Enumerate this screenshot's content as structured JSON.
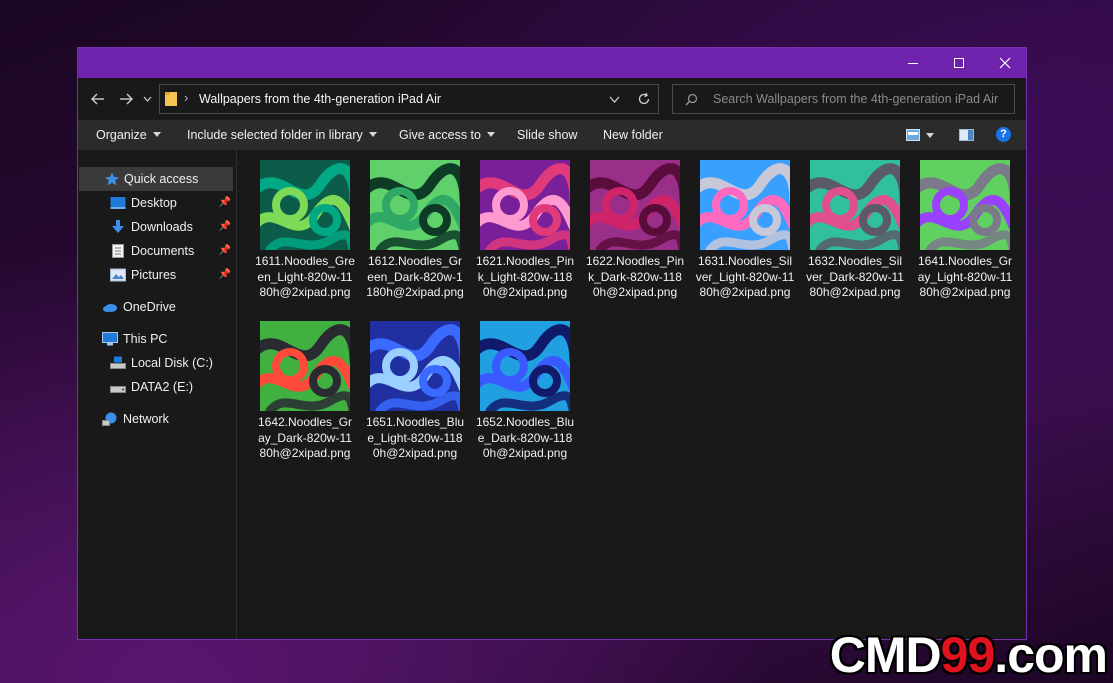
{
  "window": {
    "titlebar_color": "#6f23ad",
    "controls": [
      "minimize-icon",
      "maximize-icon",
      "close-icon"
    ]
  },
  "address": {
    "path_label": "Wallpapers from the 4th-generation iPad Air",
    "separator": "›",
    "search_placeholder": "Search Wallpapers from the 4th-generation iPad Air"
  },
  "toolbar": {
    "organize": "Organize",
    "include_library": "Include selected folder in library",
    "give_access": "Give access to",
    "slide_show": "Slide show",
    "new_folder": "New folder",
    "help": "?"
  },
  "sidebar": {
    "quick_access": "Quick access",
    "desktop": "Desktop",
    "downloads": "Downloads",
    "documents": "Documents",
    "pictures": "Pictures",
    "onedrive": "OneDrive",
    "this_pc": "This PC",
    "local_disk": "Local Disk (C:)",
    "data2": "DATA2 (E:)",
    "network": "Network"
  },
  "files": [
    {
      "name": "1611.Noodles_Green_Light-820w-1180h@2xipad.png",
      "colors": [
        "#00a884",
        "#7ed957",
        "#0c5c4a"
      ]
    },
    {
      "name": "1612.Noodles_Green_Dark-820w-1180h@2xipad.png",
      "colors": [
        "#0d3b26",
        "#2fa866",
        "#5fd06a"
      ]
    },
    {
      "name": "1621.Noodles_Pink_Light-820w-1180h@2xipad.png",
      "colors": [
        "#e03a7a",
        "#ff9ad0",
        "#7a1f9a"
      ]
    },
    {
      "name": "1622.Noodles_Pink_Dark-820w-1180h@2xipad.png",
      "colors": [
        "#5a0d3a",
        "#d0246a",
        "#9a2f8a"
      ]
    },
    {
      "name": "1631.Noodles_Silver_Light-820w-1180h@2xipad.png",
      "colors": [
        "#c8c8d8",
        "#ff6ac0",
        "#3aa0ff"
      ]
    },
    {
      "name": "1632.Noodles_Silver_Dark-820w-1180h@2xipad.png",
      "colors": [
        "#5a5a6a",
        "#e05090",
        "#30c0a0"
      ]
    },
    {
      "name": "1641.Noodles_Gray_Light-820w-1180h@2xipad.png",
      "colors": [
        "#7a7a8a",
        "#9a40ff",
        "#60d060"
      ]
    },
    {
      "name": "1642.Noodles_Gray_Dark-820w-1180h@2xipad.png",
      "colors": [
        "#2a2a32",
        "#ff4a3a",
        "#40b040"
      ]
    },
    {
      "name": "1651.Noodles_Blue_Light-820w-1180h@2xipad.png",
      "colors": [
        "#3a6aff",
        "#9ad0ff",
        "#2030a0"
      ]
    },
    {
      "name": "1652.Noodles_Blue_Dark-820w-1180h@2xipad.png",
      "colors": [
        "#101a6a",
        "#3a5aff",
        "#20a0e0"
      ]
    }
  ],
  "watermark": {
    "part1": "CMD",
    "part2": "99",
    "part3": ".com"
  }
}
